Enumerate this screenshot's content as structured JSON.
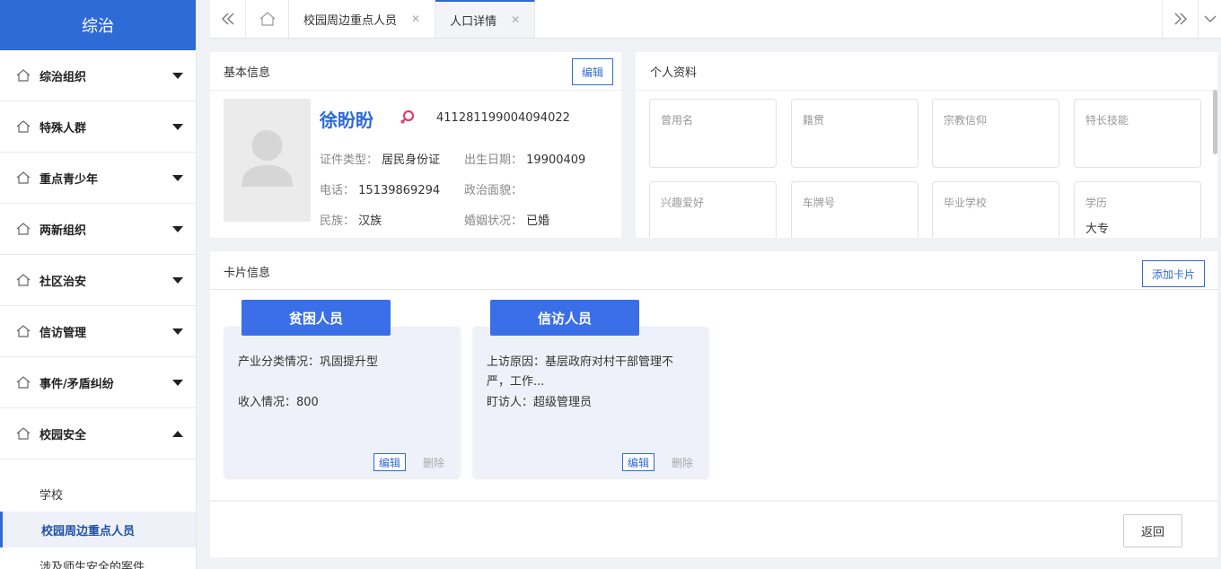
{
  "sidebar": {
    "title": "综治",
    "items": [
      {
        "label": "综治组织",
        "expanded": false
      },
      {
        "label": "特殊人群",
        "expanded": false
      },
      {
        "label": "重点青少年",
        "expanded": false
      },
      {
        "label": "两新组织",
        "expanded": false
      },
      {
        "label": "社区治安",
        "expanded": false
      },
      {
        "label": "信访管理",
        "expanded": false
      },
      {
        "label": "事件/矛盾纠纷",
        "expanded": false
      },
      {
        "label": "校园安全",
        "expanded": true
      }
    ],
    "sub_items": [
      {
        "label": "学校",
        "active": false
      },
      {
        "label": "校园周边重点人员",
        "active": true
      },
      {
        "label": "涉及师生安全的案件",
        "active": false
      }
    ]
  },
  "tabs": [
    {
      "label": "校园周边重点人员",
      "active": false
    },
    {
      "label": "人口详情",
      "active": true
    }
  ],
  "basic_info": {
    "title": "基本信息",
    "edit_label": "编辑",
    "name": "徐盼盼",
    "id_number": "411281199004094022",
    "fields": {
      "id_type": {
        "label": "证件类型：",
        "value": "居民身份证"
      },
      "birth_date": {
        "label": "出生日期：",
        "value": "19900409"
      },
      "phone": {
        "label": "电话：",
        "value": "15139869294"
      },
      "political": {
        "label": "政治面貌：",
        "value": ""
      },
      "ethnicity": {
        "label": "民族：",
        "value": "汉族"
      },
      "marital": {
        "label": "婚姻状况：",
        "value": "已婚"
      }
    }
  },
  "personal_profile": {
    "title": "个人资料",
    "cards": [
      {
        "label": "曾用名",
        "value": ""
      },
      {
        "label": "籍贯",
        "value": ""
      },
      {
        "label": "宗教信仰",
        "value": ""
      },
      {
        "label": "特长技能",
        "value": ""
      },
      {
        "label": "兴趣爱好",
        "value": ""
      },
      {
        "label": "车牌号",
        "value": ""
      },
      {
        "label": "毕业学校",
        "value": ""
      },
      {
        "label": "学历",
        "value": "大专"
      }
    ]
  },
  "card_info": {
    "title": "卡片信息",
    "add_label": "添加卡片",
    "cards": [
      {
        "title": "贫困人员",
        "line1": "产业分类情况：巩固提升型",
        "line1b": "",
        "line2": "收入情况：800",
        "edit": "编辑",
        "delete": "删除"
      },
      {
        "title": "信访人员",
        "line1": "上访原因：基层政府对村干部管理不",
        "line1b": "严，工作...",
        "line2": "盯访人：超级管理员",
        "edit": "编辑",
        "delete": "删除"
      }
    ]
  },
  "footer": {
    "back_label": "返回"
  },
  "colors": {
    "primary": "#2f6bd6",
    "card_head": "#3a6fe8",
    "gender_icon": "#e0406a"
  }
}
